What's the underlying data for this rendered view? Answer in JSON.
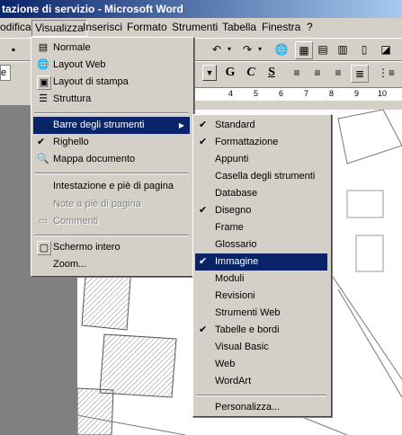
{
  "window": {
    "title": "tazione di servizio - Microsoft Word"
  },
  "menubar": {
    "items": [
      {
        "label": "odifica"
      },
      {
        "label": "Visualizza"
      },
      {
        "label": "Inserisci"
      },
      {
        "label": "Formato"
      },
      {
        "label": "Strumenti"
      },
      {
        "label": "Tabella"
      },
      {
        "label": "Finestra"
      },
      {
        "label": "?"
      }
    ]
  },
  "format_toolbar": {
    "font_value": "e",
    "bold": "G",
    "italic": "C",
    "underline": "S"
  },
  "ruler": {
    "ticks": [
      "4",
      "5",
      "6",
      "7",
      "8",
      "9",
      "10"
    ]
  },
  "view_menu": {
    "items": [
      {
        "label": "Normale",
        "icon": "normal-view-icon"
      },
      {
        "label": "Layout Web",
        "icon": "web-layout-icon"
      },
      {
        "label": "Layout di stampa",
        "icon": "print-layout-icon"
      },
      {
        "label": "Struttura",
        "icon": "outline-icon"
      },
      {
        "label": "Barre degli strumenti",
        "submenu": true
      },
      {
        "label": "Righello",
        "checked": true
      },
      {
        "label": "Mappa documento",
        "icon": "document-map-icon"
      },
      {
        "label": "Intestazione e piè di pagina"
      },
      {
        "label": "Note a piè di pagina",
        "disabled": true
      },
      {
        "label": "Commenti",
        "disabled": true,
        "icon": "comments-icon"
      },
      {
        "label": "Schermo intero",
        "icon": "full-screen-icon"
      },
      {
        "label": "Zoom..."
      }
    ]
  },
  "toolbars_submenu": {
    "items": [
      {
        "label": "Standard",
        "checked": true
      },
      {
        "label": "Formattazione",
        "checked": true
      },
      {
        "label": "Appunti"
      },
      {
        "label": "Casella degli strumenti"
      },
      {
        "label": "Database"
      },
      {
        "label": "Disegno",
        "checked": true
      },
      {
        "label": "Frame"
      },
      {
        "label": "Glossario"
      },
      {
        "label": "Immagine",
        "checked": true,
        "highlighted": true
      },
      {
        "label": "Moduli"
      },
      {
        "label": "Revisioni"
      },
      {
        "label": "Strumenti Web"
      },
      {
        "label": "Tabelle e bordi",
        "checked": true
      },
      {
        "label": "Visual Basic"
      },
      {
        "label": "Web"
      },
      {
        "label": "WordArt"
      },
      {
        "label": "Personalizza..."
      }
    ]
  },
  "colors": {
    "title_gradient_start": "#0a246a",
    "title_gradient_end": "#a6caf0",
    "menu_background": "#d4d0c8",
    "highlight": "#0a246a"
  }
}
